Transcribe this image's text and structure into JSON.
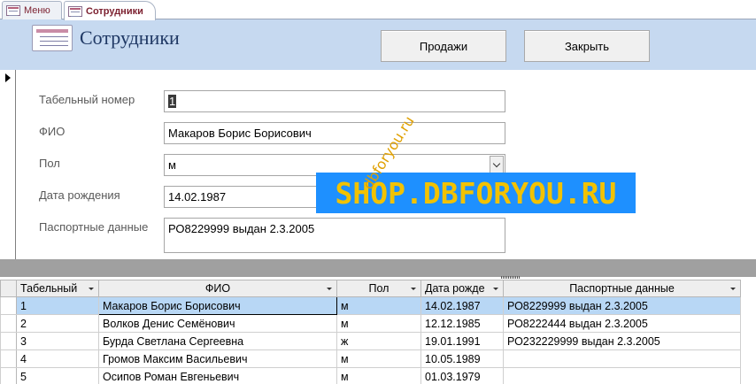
{
  "tabs": [
    {
      "label": "Меню",
      "active": false
    },
    {
      "label": "Сотрудники",
      "active": true
    }
  ],
  "header": {
    "title": "Сотрудники",
    "sales_button": "Продажи",
    "close_button": "Закрыть"
  },
  "form": {
    "fields": [
      {
        "label": "Табельный номер",
        "value": "1"
      },
      {
        "label": "ФИО",
        "value": "Макаров Борис Борисович"
      },
      {
        "label": "Пол",
        "value": "м"
      },
      {
        "label": "Дата рождения",
        "value": "14.02.1987"
      },
      {
        "label": "Паспортные данные",
        "value": "РО8229999 выдан 2.3.2005"
      }
    ]
  },
  "watermark": {
    "main": "SHOP.DBFORYOU.RU",
    "diagonal": "dbforyou.ru"
  },
  "table": {
    "columns": [
      "Табельный",
      "ФИО",
      "Пол",
      "Дата рожде",
      "Паспортные данные"
    ],
    "rows": [
      [
        "1",
        "Макаров Борис Борисович",
        "м",
        "14.02.1987",
        "РО8229999 выдан 2.3.2005"
      ],
      [
        "2",
        "Волков Денис Семёнович",
        "м",
        "12.12.1985",
        "РО8222444 выдан 2.3.2005"
      ],
      [
        "3",
        "Бурда Светлана Сергеевна",
        "ж",
        "19.01.1991",
        "РО232229999 выдан 2.3.2005"
      ],
      [
        "4",
        "Громов Максим Васильевич",
        "м",
        "10.05.1989",
        ""
      ],
      [
        "5",
        "Осипов Роман Евгеньевич",
        "м",
        "01.03.1979",
        ""
      ]
    ]
  },
  "colors": {
    "header_band": "#c6d9f0",
    "title": "#1f3864",
    "highlight_row": "#b8d7f5",
    "watermark_band": "#1e90ff",
    "watermark_text": "#f2c200"
  }
}
